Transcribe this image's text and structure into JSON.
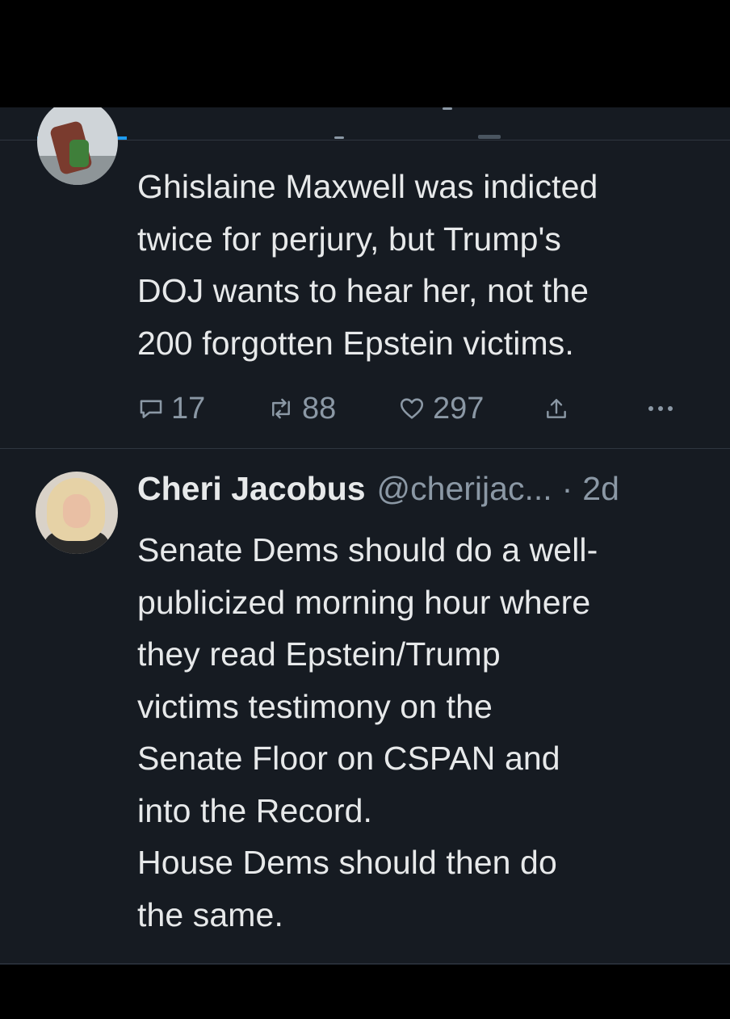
{
  "colors": {
    "background": "#161b22",
    "text": "#e7e9ea",
    "muted": "#8b98a5",
    "accent": "#1d9bf0",
    "divider": "#2f3640"
  },
  "tweet1": {
    "text_lines": [
      "Ghislaine Maxwell was indicted",
      "twice for perjury, but Trump's",
      "DOJ wants to hear her, not the",
      "200 forgotten Epstein victims."
    ],
    "actions": {
      "reply_icon": "reply-icon",
      "reply_count": "17",
      "retweet_icon": "retweet-icon",
      "retweet_count": "88",
      "like_icon": "heart-icon",
      "like_count": "297",
      "share_icon": "share-icon",
      "more_icon": "more-icon"
    }
  },
  "tweet2": {
    "name": "Cheri Jacobus",
    "handle": "@cherijac...",
    "separator": "·",
    "time": "2d",
    "text_lines": [
      "Senate Dems should do a well-",
      "publicized morning hour where",
      "they read Epstein/Trump",
      "victims testimony on the",
      "Senate Floor on CSPAN and",
      "into the Record.",
      "House Dems should then do",
      "the same."
    ]
  }
}
